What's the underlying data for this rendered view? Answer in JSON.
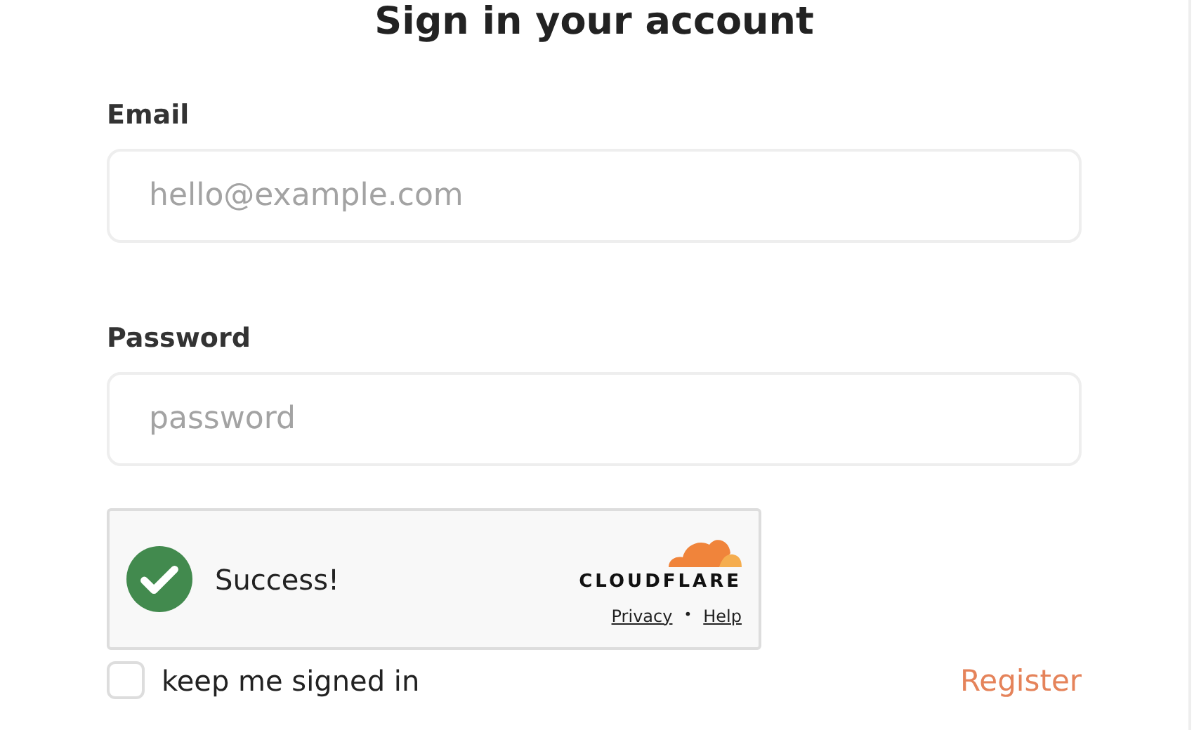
{
  "title": "Sign in your account",
  "fields": [
    {
      "label": "Email",
      "placeholder": "hello@example.com"
    },
    {
      "label": "Password",
      "placeholder": "password"
    }
  ],
  "captcha": {
    "status": "Success!",
    "verified": true,
    "brand": "CLOUDFLARE",
    "links": [
      "Privacy",
      "Help"
    ],
    "separator": "•"
  },
  "remember": {
    "label": "keep me signed in",
    "checked": false
  },
  "register_link": "Register"
}
